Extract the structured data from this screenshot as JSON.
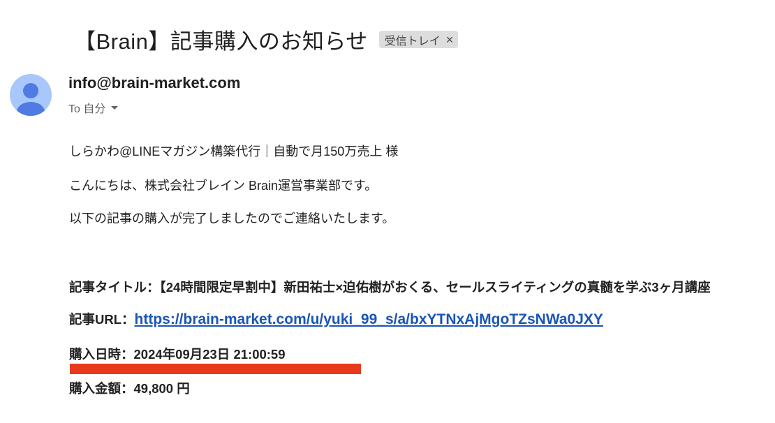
{
  "email": {
    "subject": "【Brain】記事購入のお知らせ",
    "label_chip": "受信トレイ",
    "label_close": "×",
    "sender": "info@brain-market.com",
    "recipient": "To 自分"
  },
  "body": {
    "greeting": "しらかわ@LINEマガジン構築代行｜自動で月150万売上 様",
    "intro": "こんにちは、株式会社ブレイン Brain運営事業部です。",
    "notice": "以下の記事の購入が完了しましたのでご連絡いたします。",
    "article_title_line": "記事タイトル：【24時間限定早割中】新田祐士×迫佑樹がおくる、セールスライティングの真髄を学ぶ3ヶ月講座",
    "article_url_label": "記事URL：",
    "article_url": "https://brain-market.com/u/yuki_99_s/a/bxYTNxAjMgoTZsNWa0JXY",
    "purchase_date_line": "購入日時：2024年09月23日 21:00:59",
    "purchase_amount_line": "購入金額：49,800 円"
  },
  "colors": {
    "link": "#1a55b8",
    "highlight_bar": "#e8391d",
    "avatar_bg": "#a8c7fa",
    "avatar_fg": "#4f7be3"
  },
  "icons": {
    "avatar": "person-icon",
    "chip_close": "close-icon",
    "recipient_caret": "caret-down-icon"
  }
}
